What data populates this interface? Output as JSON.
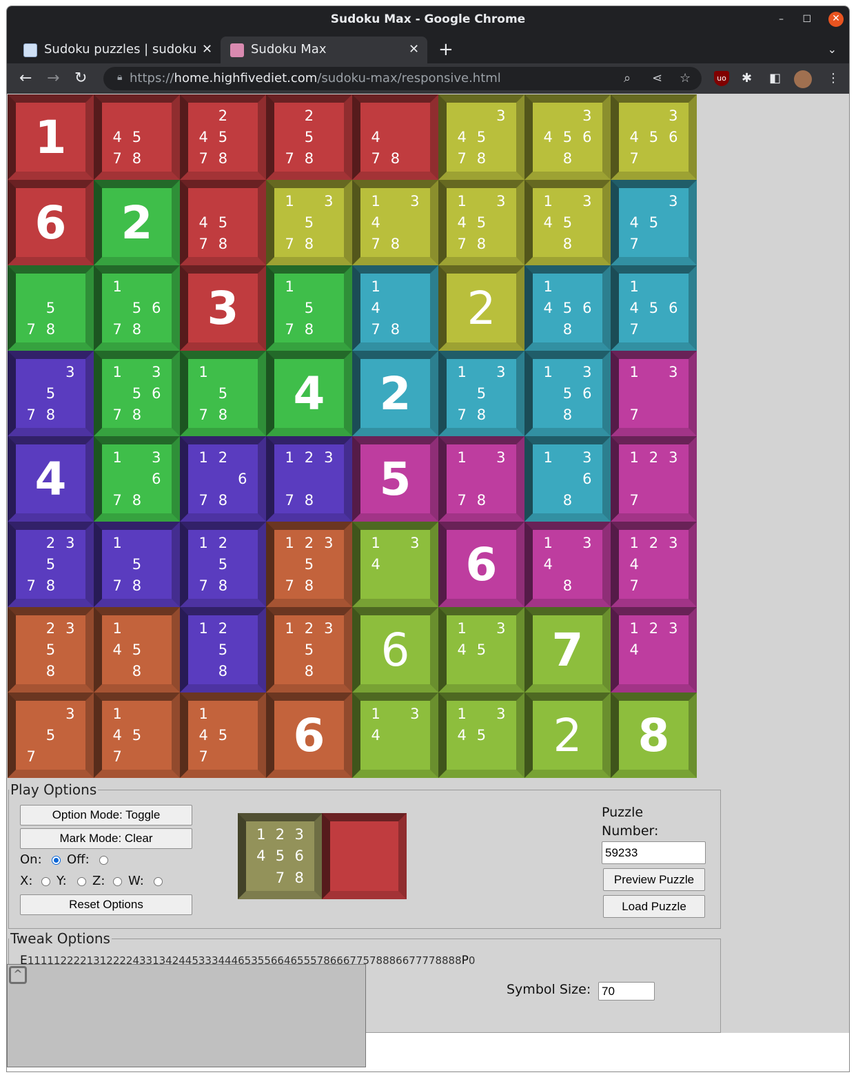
{
  "window": {
    "title": "Sudoku Max - Google Chrome",
    "controls": [
      "–",
      "☐",
      "✕"
    ]
  },
  "tabs": [
    {
      "title": "Sudoku puzzles | sudoku & more",
      "close": "✕",
      "active": false
    },
    {
      "title": "Sudoku Max",
      "close": "✕",
      "active": true
    }
  ],
  "toolbar": {
    "url_prefix": "https://",
    "url_host": "home.highfivediet.com",
    "url_path": "/sudoku-max/responsive.html"
  },
  "icons": {
    "back": "back-arrow-icon",
    "forward": "forward-arrow-icon",
    "reload": "reload-icon",
    "lock": "lock-icon",
    "zoom": "zoom-icon",
    "share": "share-icon",
    "bookmark": "star-icon",
    "ublock": "ublock-icon",
    "extensions": "puzzle-piece-icon",
    "sidepanel": "side-panel-icon",
    "menu": "kebab-menu-icon"
  },
  "colors": {
    "red": "#c03c3f",
    "yellow": "#b9bf3c",
    "green": "#3fbe4a",
    "teal": "#3ba9bf",
    "purple": "#5a3cbf",
    "magenta": "#be3d9f",
    "orange": "#c3633c",
    "lime": "#8dbe3d",
    "preview_note": "#93925a"
  },
  "board": {
    "regions": [
      [
        "red",
        "red",
        "red",
        "red",
        "red",
        "yellow",
        "yellow",
        "yellow"
      ],
      [
        "red",
        "green",
        "red",
        "yellow",
        "yellow",
        "yellow",
        "yellow",
        "teal"
      ],
      [
        "green",
        "green",
        "red",
        "green",
        "teal",
        "yellow",
        "teal",
        "teal"
      ],
      [
        "purple",
        "green",
        "green",
        "green",
        "teal",
        "teal",
        "teal",
        "magenta"
      ],
      [
        "purple",
        "green",
        "purple",
        "purple",
        "magenta",
        "magenta",
        "teal",
        "magenta"
      ],
      [
        "purple",
        "purple",
        "purple",
        "orange",
        "lime",
        "magenta",
        "magenta",
        "magenta"
      ],
      [
        "orange",
        "orange",
        "purple",
        "orange",
        "lime",
        "lime",
        "lime",
        "magenta"
      ],
      [
        "orange",
        "orange",
        "orange",
        "orange",
        "lime",
        "lime",
        "lime",
        "lime"
      ]
    ],
    "cells": [
      [
        {
          "given": "1"
        },
        {
          "notes": [
            "",
            "",
            "",
            "4",
            "5",
            "",
            "7",
            "8",
            ""
          ]
        },
        {
          "notes": [
            "",
            "2",
            "",
            "4",
            "5",
            "",
            "7",
            "8",
            ""
          ]
        },
        {
          "notes": [
            "",
            "2",
            "",
            "",
            "5",
            "",
            "7",
            "8",
            ""
          ]
        },
        {
          "notes": [
            "",
            "",
            "",
            "4",
            "",
            "",
            "7",
            "8",
            ""
          ]
        },
        {
          "notes": [
            "",
            "",
            "3",
            "4",
            "5",
            "",
            "7",
            "8",
            ""
          ]
        },
        {
          "notes": [
            "",
            "",
            "3",
            "4",
            "5",
            "6",
            "",
            "8",
            ""
          ]
        },
        {
          "notes": [
            "",
            "",
            "3",
            "4",
            "5",
            "6",
            "7",
            "",
            ""
          ]
        }
      ],
      [
        {
          "given": "6"
        },
        {
          "given": "2"
        },
        {
          "notes": [
            "",
            "",
            "",
            "4",
            "5",
            "",
            "7",
            "8",
            ""
          ]
        },
        {
          "notes": [
            "1",
            "",
            "3",
            "",
            "5",
            "",
            "7",
            "8",
            ""
          ]
        },
        {
          "notes": [
            "1",
            "",
            "3",
            "4",
            "",
            "",
            "7",
            "8",
            ""
          ]
        },
        {
          "notes": [
            "1",
            "",
            "3",
            "4",
            "5",
            "",
            "7",
            "8",
            ""
          ]
        },
        {
          "notes": [
            "1",
            "",
            "3",
            "4",
            "5",
            "",
            "",
            "8",
            ""
          ]
        },
        {
          "notes": [
            "",
            "",
            "3",
            "4",
            "5",
            "",
            "7",
            "",
            ""
          ]
        }
      ],
      [
        {
          "notes": [
            "",
            "",
            "",
            "",
            "5",
            "",
            "7",
            "8",
            ""
          ]
        },
        {
          "notes": [
            "1",
            "",
            "",
            "",
            "5",
            "6",
            "7",
            "8",
            ""
          ]
        },
        {
          "given": "3"
        },
        {
          "notes": [
            "1",
            "",
            "",
            "",
            "5",
            "",
            "7",
            "8",
            ""
          ]
        },
        {
          "notes": [
            "1",
            "",
            "",
            "4",
            "",
            "",
            "7",
            "8",
            ""
          ]
        },
        {
          "given": "2",
          "thin": true
        },
        {
          "notes": [
            "1",
            "",
            "",
            "4",
            "5",
            "6",
            "",
            "8",
            ""
          ]
        },
        {
          "notes": [
            "1",
            "",
            "",
            "4",
            "5",
            "6",
            "7",
            "",
            ""
          ]
        }
      ],
      [
        {
          "notes": [
            "",
            "",
            "3",
            "",
            "5",
            "",
            "7",
            "8",
            ""
          ]
        },
        {
          "notes": [
            "1",
            "",
            "3",
            "",
            "5",
            "6",
            "7",
            "8",
            ""
          ]
        },
        {
          "notes": [
            "1",
            "",
            "",
            "",
            "5",
            "",
            "7",
            "8",
            ""
          ]
        },
        {
          "given": "4"
        },
        {
          "given": "2"
        },
        {
          "notes": [
            "1",
            "",
            "3",
            "",
            "5",
            "",
            "7",
            "8",
            ""
          ]
        },
        {
          "notes": [
            "1",
            "",
            "3",
            "",
            "5",
            "6",
            "",
            "8",
            ""
          ]
        },
        {
          "notes": [
            "1",
            "",
            "3",
            "",
            "",
            "",
            "7",
            "",
            ""
          ]
        }
      ],
      [
        {
          "given": "4"
        },
        {
          "notes": [
            "1",
            "",
            "3",
            "",
            "",
            "6",
            "7",
            "8",
            ""
          ]
        },
        {
          "notes": [
            "1",
            "2",
            "",
            "",
            "",
            "6",
            "7",
            "8",
            ""
          ]
        },
        {
          "notes": [
            "1",
            "2",
            "3",
            "",
            "",
            "",
            "7",
            "8",
            ""
          ]
        },
        {
          "given": "5"
        },
        {
          "notes": [
            "1",
            "",
            "3",
            "",
            "",
            "",
            "7",
            "8",
            ""
          ]
        },
        {
          "notes": [
            "1",
            "",
            "3",
            "",
            "",
            "6",
            "",
            "8",
            ""
          ]
        },
        {
          "notes": [
            "1",
            "2",
            "3",
            "",
            "",
            "",
            "7",
            "",
            ""
          ]
        }
      ],
      [
        {
          "notes": [
            "",
            "2",
            "3",
            "",
            "5",
            "",
            "7",
            "8",
            ""
          ]
        },
        {
          "notes": [
            "1",
            "",
            "",
            "",
            "5",
            "",
            "7",
            "8",
            ""
          ]
        },
        {
          "notes": [
            "1",
            "2",
            "",
            "",
            "5",
            "",
            "7",
            "8",
            ""
          ]
        },
        {
          "notes": [
            "1",
            "2",
            "3",
            "",
            "5",
            "",
            "7",
            "8",
            ""
          ]
        },
        {
          "notes": [
            "1",
            "",
            "3",
            "4",
            "",
            "",
            "",
            "",
            ""
          ]
        },
        {
          "given": "6"
        },
        {
          "notes": [
            "1",
            "",
            "3",
            "4",
            "",
            "",
            "",
            "8",
            ""
          ]
        },
        {
          "notes": [
            "1",
            "2",
            "3",
            "4",
            "",
            "",
            "7",
            "",
            ""
          ]
        }
      ],
      [
        {
          "notes": [
            "",
            "2",
            "3",
            "",
            "5",
            "",
            "",
            "8",
            ""
          ]
        },
        {
          "notes": [
            "1",
            "",
            "",
            "4",
            "5",
            "",
            "",
            "8",
            ""
          ]
        },
        {
          "notes": [
            "1",
            "2",
            "",
            "",
            "5",
            "",
            "",
            "8",
            ""
          ]
        },
        {
          "notes": [
            "1",
            "2",
            "3",
            "",
            "5",
            "",
            "",
            "8",
            ""
          ]
        },
        {
          "given": "6",
          "thin": true
        },
        {
          "notes": [
            "1",
            "",
            "3",
            "4",
            "5",
            "",
            "",
            "",
            ""
          ]
        },
        {
          "given": "7"
        },
        {
          "notes": [
            "1",
            "2",
            "3",
            "4",
            "",
            "",
            "",
            "",
            ""
          ]
        }
      ],
      [
        {
          "notes": [
            "",
            "",
            "3",
            "",
            "5",
            "",
            "7",
            "",
            ""
          ]
        },
        {
          "notes": [
            "1",
            "",
            "",
            "4",
            "5",
            "",
            "7",
            "",
            ""
          ]
        },
        {
          "notes": [
            "1",
            "",
            "",
            "4",
            "5",
            "",
            "7",
            "",
            ""
          ]
        },
        {
          "given": "6"
        },
        {
          "notes": [
            "1",
            "",
            "3",
            "4",
            "",
            "",
            "",
            "",
            ""
          ]
        },
        {
          "notes": [
            "1",
            "",
            "3",
            "4",
            "5",
            "",
            "",
            "",
            ""
          ]
        },
        {
          "given": "2",
          "thin": true
        },
        {
          "given": "8"
        }
      ]
    ]
  },
  "play_options": {
    "legend": "Play Options",
    "option_mode_button": "Option Mode: Toggle",
    "mark_mode_button": "Mark Mode: Clear",
    "on_label": "On:",
    "off_label": "Off:",
    "on_checked": true,
    "x_label": "X:",
    "y_label": "Y:",
    "z_label": "Z:",
    "w_label": "W:",
    "reset_button": "Reset Options",
    "preview_notes": [
      "1",
      "2",
      "3",
      "4",
      "5",
      "6",
      "",
      "7",
      "8"
    ],
    "puzzle_number_label": "Puzzle Number:",
    "puzzle_number_value": "59233",
    "preview_button": "Preview Puzzle",
    "load_button": "Load Puzzle"
  },
  "tweak_options": {
    "legend": "Tweak Options",
    "encoding_prefix": "E",
    "encoding_text": "111112222131222243313424453334446535566465557866677578886677778888",
    "encoding_p": "P",
    "encoding_suffix": "0",
    "symbol_size_label": "Symbol Size:",
    "symbol_size_value": "70"
  },
  "overlay": {
    "toggle_label": "^"
  }
}
